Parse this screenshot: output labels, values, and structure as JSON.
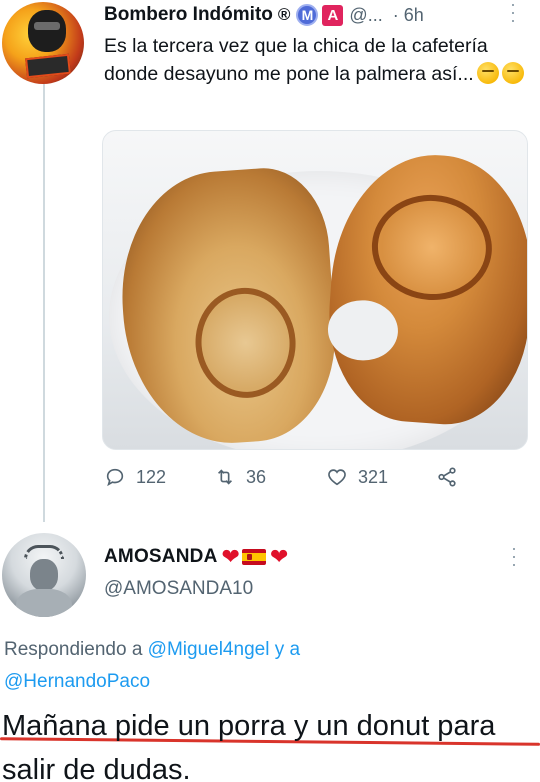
{
  "tweet1": {
    "author_name": "Bombero Indómito",
    "name_symbol": "®",
    "badge_m": "M",
    "badge_a": "A",
    "handle": "@...",
    "time": "· 6h",
    "more": "⋮",
    "text": "Es la tercera vez que la chica de la cafetería donde desayuno me pone la palmera así...",
    "emojis": [
      "thinking-face",
      "thinking-face"
    ],
    "actions": {
      "replies": "122",
      "retweets": "36",
      "likes": "321"
    }
  },
  "tweet2": {
    "author_name": "AMOSANDA",
    "name_emojis": [
      "red-heart",
      "spain-flag",
      "red-heart"
    ],
    "heart_glyph": "❤",
    "handle": "@AMOSANDA10",
    "more": "⋮",
    "replying_prefix": "Respondiendo a",
    "mention1": "@Miguel4ngel",
    "replying_and": "y a",
    "mention2": "@HernandoPaco",
    "text": "Mañana pide un porra y un donut para salir de dudas."
  },
  "colors": {
    "text_primary": "#0f1419",
    "text_secondary": "#536471",
    "link": "#1d9bf0",
    "heart_red": "#e0112b",
    "annotation_red": "#d9342b"
  }
}
